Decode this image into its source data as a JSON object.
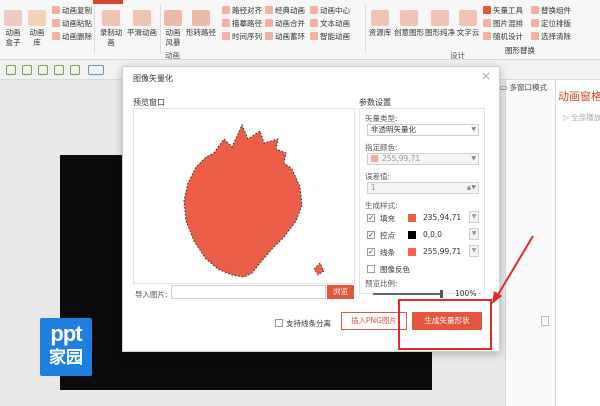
{
  "ribbon": {
    "items": [
      {
        "label": "动画盒子"
      },
      {
        "label": "动画库"
      },
      {
        "label": "动画复制"
      },
      {
        "label": "动画粘贴"
      },
      {
        "label": "动画删除"
      },
      {
        "label": "录制动画"
      },
      {
        "label": "平滑动画"
      },
      {
        "label": "动画风暴"
      },
      {
        "label": "形转路径"
      },
      {
        "label": "路径对齐"
      },
      {
        "label": "描摹路径"
      },
      {
        "label": "时间序列"
      },
      {
        "label": "经典动画"
      },
      {
        "label": "动画合并"
      },
      {
        "label": "动画蓄环"
      },
      {
        "label": "动画中心"
      },
      {
        "label": "文本动画"
      },
      {
        "label": "智能动画"
      },
      {
        "label": "资源库"
      },
      {
        "label": "创意图形"
      },
      {
        "label": "图形纯净"
      },
      {
        "label": "文字云"
      },
      {
        "label": "矢量工具"
      },
      {
        "label": "图片混排"
      },
      {
        "label": "图形替换"
      },
      {
        "label": "随机设计"
      },
      {
        "label": "替换组件"
      },
      {
        "label": "定位排版"
      },
      {
        "label": "选择清除"
      }
    ],
    "group_animation": "动画",
    "group_design": "设计"
  },
  "workspace": {
    "multi_window": "多窗口模式",
    "panel_title": "动画窗格",
    "panel_sub": "全部播放",
    "logo_line1": "ppt",
    "logo_line2": "家园"
  },
  "dialog": {
    "title": "图像矢量化",
    "close": "×",
    "preview_label": "预览窗口",
    "params_label": "参数设置",
    "vector_type_label": "矢量类型:",
    "vector_type_value": "非透明矢量化",
    "color_label": "指定颜色:",
    "color_value": "255,99,71",
    "tolerance_label": "误差值:",
    "tolerance_value": "1",
    "style_label": "生成样式:",
    "fill_label": "填充",
    "fill_value": "235,94,71",
    "control_label": "控点",
    "control_value": "0,0,0",
    "line_label": "线条",
    "line_value": "255,99,71",
    "invert_label": "图像反色",
    "scale_label": "预览比例:",
    "scale_value": "100%",
    "import_label": "导入图片:",
    "browse_label": "浏览",
    "separate_label": "支持线条分离",
    "insert_png_label": "插入PNG图片",
    "generate_label": "生成矢量形状"
  },
  "colors": {
    "accent": "#e4573d",
    "strawberry": "#eb5e47",
    "annotation": "#e12b2b",
    "logo": "#1f7fe0"
  },
  "preview_scale": 1.0
}
